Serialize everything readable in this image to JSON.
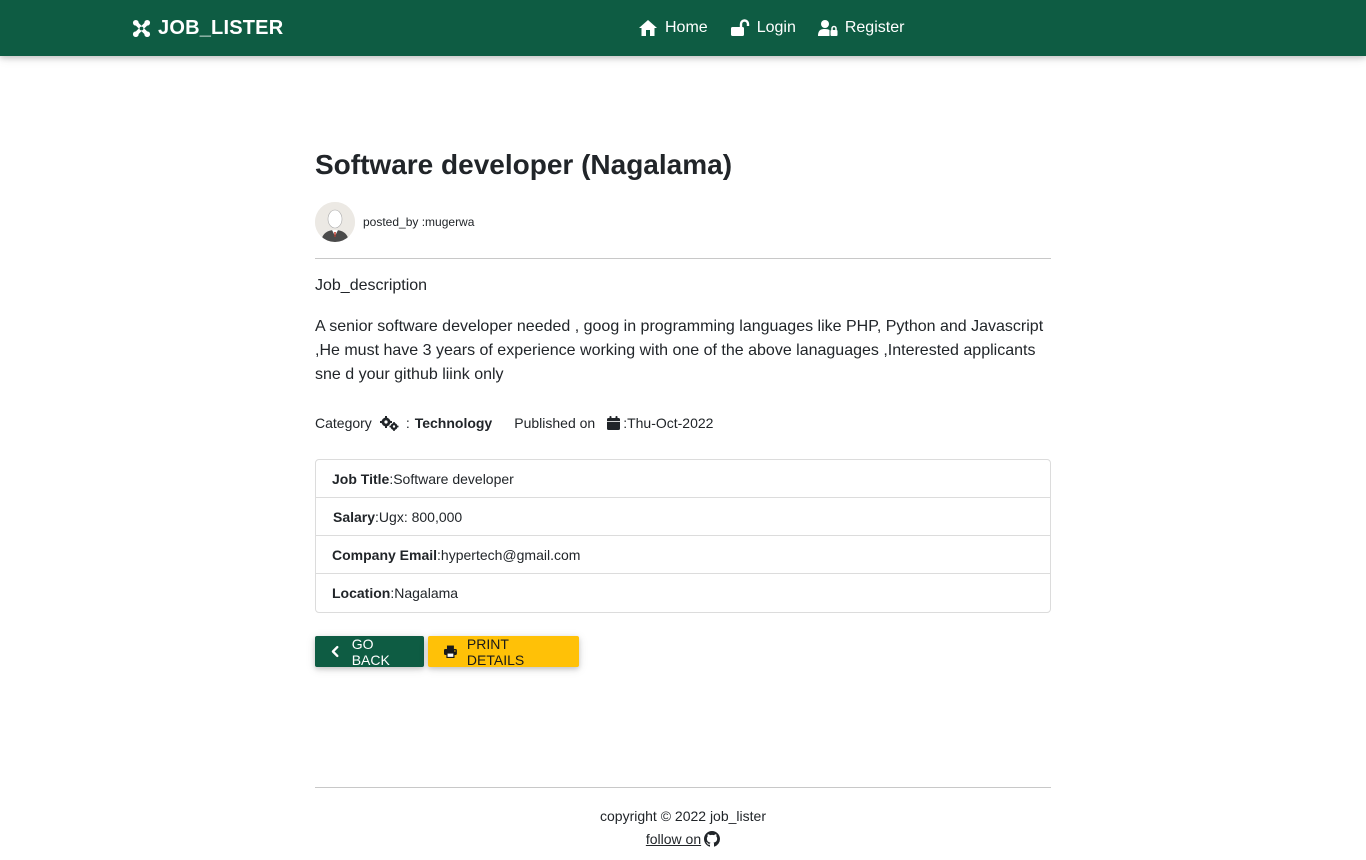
{
  "navbar": {
    "brand": "JOB_LISTER",
    "links": [
      {
        "label": "Home",
        "icon": "home-icon"
      },
      {
        "label": "Login",
        "icon": "unlock-icon"
      },
      {
        "label": "Register",
        "icon": "user-lock-icon"
      }
    ]
  },
  "job": {
    "title": "Software developer (Nagalama)",
    "posted_by": "posted_by :mugerwa",
    "description_label": "Job_description",
    "description": "A senior software developer needed , goog in programming languages like PHP, Python and Javascript ,He must have 3 years of experience working with one of the above lanaguages ,Interested applicants sne d your github liink only",
    "category_label": "Category",
    "category_sep": ":",
    "category_value": "Technology",
    "published_label": "Published on",
    "published_value": ":Thu-Oct-2022"
  },
  "details": [
    {
      "label": "Job Title",
      "value": ":Software developer"
    },
    {
      "label": "Salary",
      "value": ":Ugx: 800,000"
    },
    {
      "label": "Company Email",
      "value": ":hypertech@gmail.com"
    },
    {
      "label": "Location",
      "value": ":Nagalama"
    }
  ],
  "buttons": {
    "back": "GO BACK",
    "print": "PRINT DETAILS"
  },
  "footer": {
    "copyright": "copyright © 2022  job_lister",
    "follow": "follow on"
  },
  "colors": {
    "primary": "#0e5c43",
    "warning": "#ffc107"
  }
}
